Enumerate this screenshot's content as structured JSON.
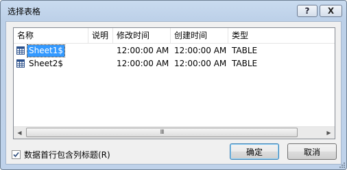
{
  "dialog": {
    "title": "选择表格",
    "help_glyph": "?",
    "close_glyph": "X"
  },
  "list": {
    "columns": [
      "名称",
      "说明",
      "修改时间",
      "创建时间",
      "类型"
    ],
    "rows": [
      {
        "name": "Sheet1$",
        "description": "",
        "modified": "12:00:00 AM",
        "created": "12:00:00 AM",
        "type": "TABLE",
        "selected": true
      },
      {
        "name": "Sheet2$",
        "description": "",
        "modified": "12:00:00 AM",
        "created": "12:00:00 AM",
        "type": "TABLE",
        "selected": false
      }
    ],
    "scroll_thumb_glyph": "III"
  },
  "options": {
    "first_row_header_label": "数据首行包含列标题(R)",
    "first_row_header_checked": true
  },
  "buttons": {
    "ok_label": "确定",
    "cancel_label": "取消"
  },
  "icons": {
    "row_icon": "table-icon",
    "help": "help-icon",
    "close": "close-icon",
    "checkbox": "check-icon"
  },
  "colors": {
    "selection": "#3399ff",
    "title_bar": "#bcd0e8"
  }
}
